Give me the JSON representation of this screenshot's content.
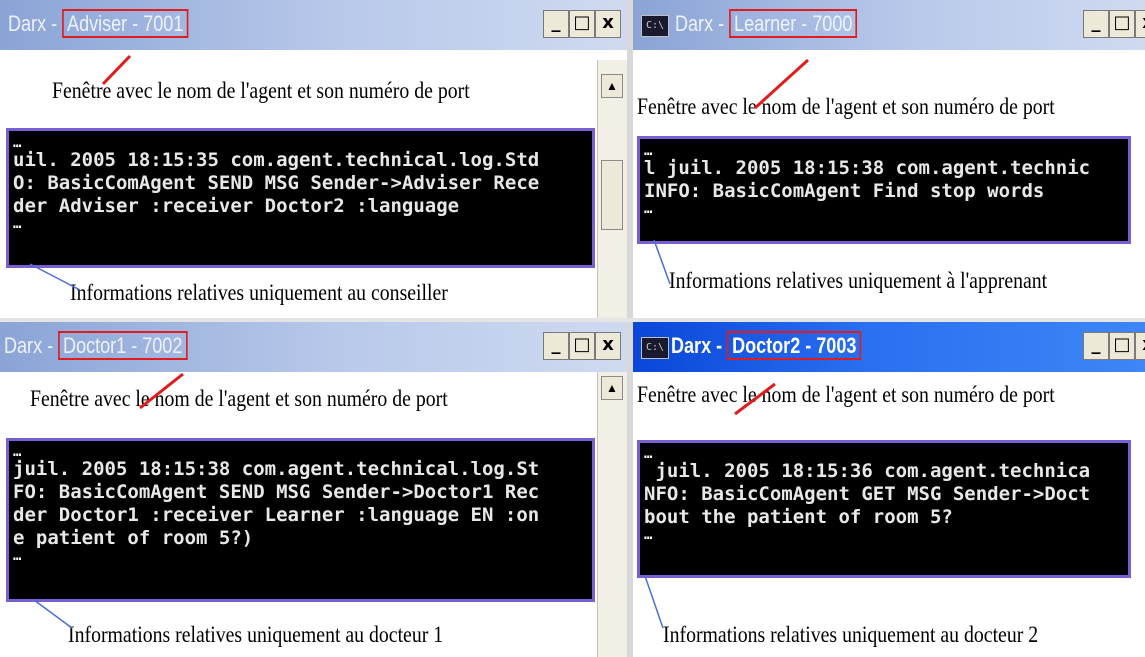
{
  "windows": {
    "adviser": {
      "title_prefix": "Darx - ",
      "agent_label": "Adviser - 7001",
      "caption_top": "Fenêtre avec le nom de l'agent et son numéro de port",
      "console_lines": [
        "…",
        "uil. 2005 18:15:35 com.agent.technical.log.Std",
        "O: BasicComAgent SEND MSG Sender->Adviser Rece",
        "der Adviser :receiver Doctor2 :language",
        "…"
      ],
      "caption_bottom": "Informations relatives uniquement au conseiller"
    },
    "learner": {
      "title_prefix": "Darx - ",
      "agent_label": "Learner - 7000",
      "caption_top": "Fenêtre avec le nom de l'agent et son numéro de port",
      "console_lines": [
        "…",
        "l juil. 2005 18:15:38 com.agent.technic",
        "INFO: BasicComAgent Find stop words",
        "…"
      ],
      "caption_bottom": "Informations relatives uniquement à l'apprenant"
    },
    "doctor1": {
      "title_prefix": "Darx - ",
      "agent_label": "Doctor1 - 7002",
      "caption_top": "Fenêtre avec le nom de l'agent et son numéro de port",
      "console_lines": [
        "…",
        "juil. 2005 18:15:38 com.agent.technical.log.St",
        "FO: BasicComAgent SEND MSG Sender->Doctor1 Rec",
        "der Doctor1 :receiver Learner :language EN :on",
        "e patient of room 5?)",
        "…"
      ],
      "caption_bottom": "Informations relatives uniquement au docteur 1"
    },
    "doctor2": {
      "title_prefix": "Darx - ",
      "agent_label": "Doctor2 - 7003",
      "caption_top": "Fenêtre avec le nom de l'agent et son numéro de port",
      "console_lines": [
        "…",
        " juil. 2005 18:15:36 com.agent.technica",
        "NFO: BasicComAgent GET MSG Sender->Doct",
        "bout the patient of room 5?",
        "…"
      ],
      "caption_bottom": "Informations relatives uniquement au docteur 2"
    }
  },
  "window_buttons": {
    "minimize": "_",
    "maximize": "□",
    "close": "x"
  },
  "icons": {
    "console": "C:\\"
  },
  "colors": {
    "annotation_red": "#e01c1c",
    "console_border": "#7a5fd4",
    "title_active": "#0a46d8",
    "title_inactive": "#8aa4d6"
  }
}
